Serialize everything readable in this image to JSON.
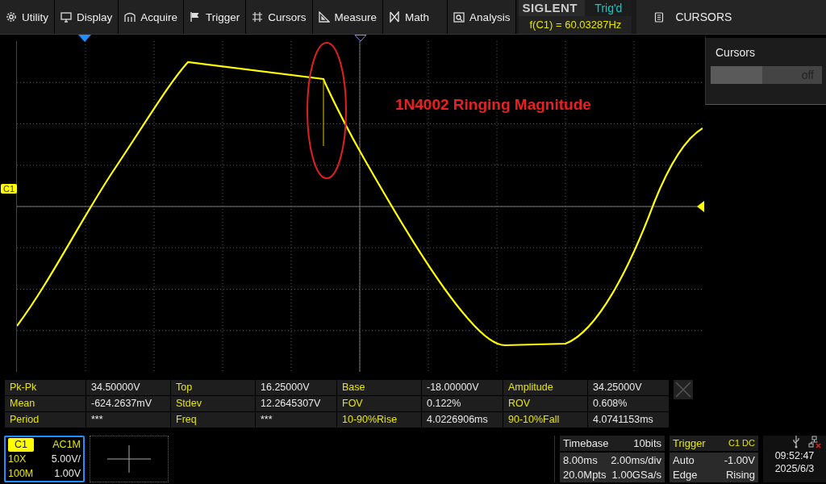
{
  "menu": [
    {
      "label": "Utility"
    },
    {
      "label": "Display"
    },
    {
      "label": "Acquire"
    },
    {
      "label": "Trigger"
    },
    {
      "label": "Cursors"
    },
    {
      "label": "Measure"
    },
    {
      "label": "Math"
    },
    {
      "label": "Analysis"
    }
  ],
  "brand": {
    "logo": "SIGLENT",
    "status": "Trig'd",
    "frequency": "f(C1) = 60.03287Hz"
  },
  "right_panel": {
    "title": "CURSORS",
    "section": "Cursors",
    "toggle": {
      "label": "off",
      "on": false
    }
  },
  "screen": {
    "channel_marker": "C1",
    "annotation": "1N4002 Ringing Magnitude"
  },
  "measurements": [
    [
      {
        "name": "Pk-Pk",
        "value": "34.50000V"
      },
      {
        "name": "Top",
        "value": "16.25000V"
      },
      {
        "name": "Base",
        "value": "-18.00000V"
      },
      {
        "name": "Amplitude",
        "value": "34.25000V"
      }
    ],
    [
      {
        "name": "Mean",
        "value": "-624.2637mV"
      },
      {
        "name": "Stdev",
        "value": "12.2645307V"
      },
      {
        "name": "FOV",
        "value": "0.122%"
      },
      {
        "name": "ROV",
        "value": "0.608%"
      }
    ],
    [
      {
        "name": "Period",
        "value": "***"
      },
      {
        "name": "Freq",
        "value": "***"
      },
      {
        "name": "10-90%Rise",
        "value": "4.0226906ms"
      },
      {
        "name": "90-10%Fall",
        "value": "4.0741153ms"
      }
    ]
  ],
  "channel": {
    "label": "C1",
    "coupling": "AC1M",
    "probe": "10X",
    "scale": "5.00V/",
    "bandwidth": "100M",
    "offset": "1.00V"
  },
  "timebase": {
    "title": "Timebase",
    "bits": "10bits",
    "delay": "8.00ms",
    "scale": "2.00ms/div",
    "points": "20.0Mpts",
    "rate": "1.00GSa/s"
  },
  "trigger": {
    "title": "Trigger",
    "source": "C1 DC",
    "mode": "Auto",
    "level": "-1.00V",
    "type": "Edge",
    "slope": "Rising"
  },
  "clock": {
    "time": "09:52:47",
    "date": "2025/6/3"
  }
}
